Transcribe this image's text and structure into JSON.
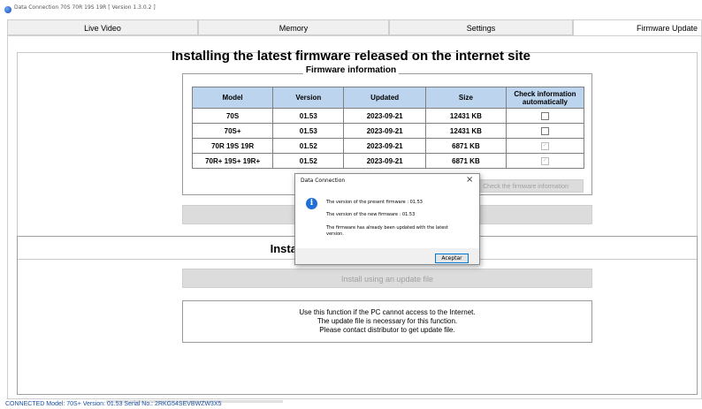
{
  "window": {
    "title": "Data Connection 70S 70R 19S 19R [ Version 1.3.0.2 ]"
  },
  "tabs": [
    {
      "label": "Live Video"
    },
    {
      "label": "Memory"
    },
    {
      "label": "Settings"
    },
    {
      "label": "Firmware Update"
    }
  ],
  "internet_section": {
    "heading": "Installing the latest firmware released on the internet site",
    "legend": "Firmware information",
    "table": {
      "headers": [
        "Model",
        "Version",
        "Updated",
        "Size",
        "Check information automatically"
      ],
      "rows": [
        {
          "model": "70S",
          "version": "01.53",
          "updated": "2023-09-21",
          "size": "12431 KB",
          "check": "unchecked"
        },
        {
          "model": "70S+",
          "version": "01.53",
          "updated": "2023-09-21",
          "size": "12431 KB",
          "check": "unchecked"
        },
        {
          "model": "70R 19S 19R",
          "version": "01.52",
          "updated": "2023-09-21",
          "size": "6871 KB",
          "check": "checked-disabled"
        },
        {
          "model": "70R+ 19S+ 19R+",
          "version": "01.52",
          "updated": "2023-09-21",
          "size": "6871 KB",
          "check": "checked-disabled"
        }
      ]
    },
    "check_button": "Check the firmware information"
  },
  "file_section": {
    "heading": "Installing using an update file",
    "install_button": "Install using an update file",
    "info_lines": [
      "Use this function if the PC cannot access to the Internet.",
      "The update file is necessary for this function.",
      "Please contact distributor to get update file."
    ]
  },
  "status_bar": {
    "text": "CONNECTED     Model: 70S+  Version: 01.53  Serial No.: 2RKG54SEVBWZW3X5"
  },
  "dialog": {
    "title": "Data Connection",
    "close": "×",
    "icon": "info-icon",
    "lines": [
      "The version of the present firmware : 01.53",
      "The version of the new firmware : 01.53",
      "The firmware has already been updated with the latest",
      "version."
    ],
    "ok_button": "Aceptar"
  }
}
